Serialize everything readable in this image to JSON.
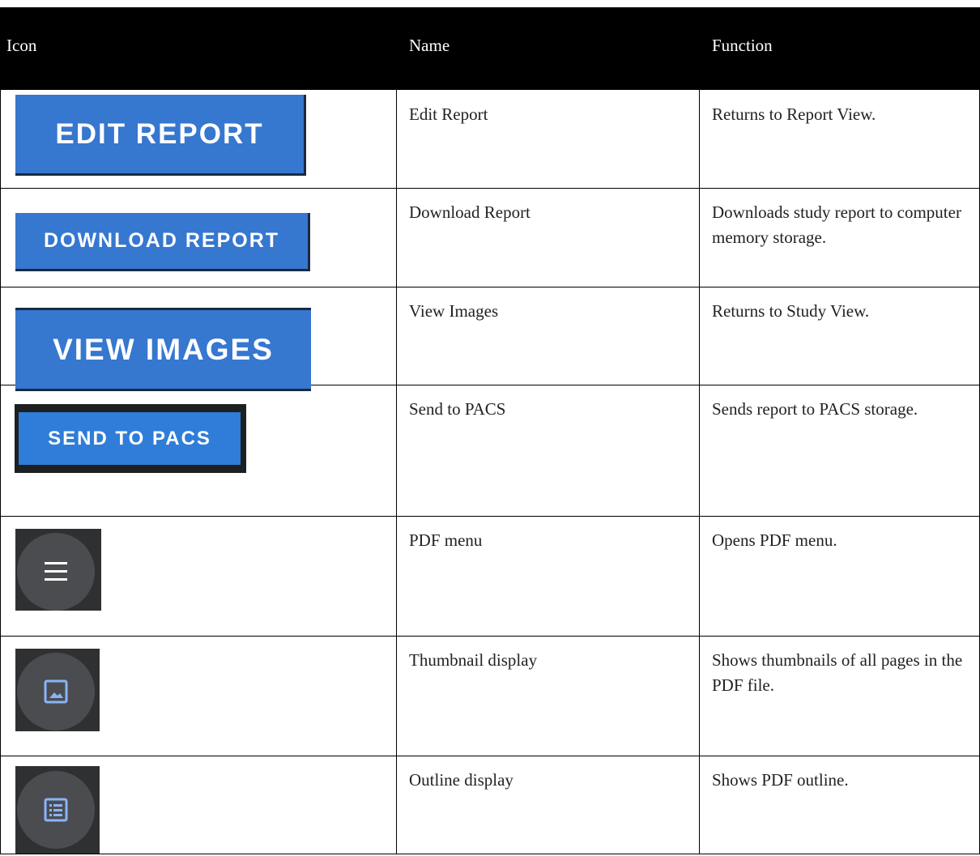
{
  "headers": {
    "icon": "Icon",
    "name": "Name",
    "function": "Function"
  },
  "rows": [
    {
      "button_label": "EDIT REPORT",
      "name": "Edit Report",
      "function": "Returns to Report View."
    },
    {
      "button_label": "DOWNLOAD REPORT",
      "name": "Download Report",
      "function": "Downloads study report to computer memory storage."
    },
    {
      "button_label": "VIEW IMAGES",
      "name": "View Images",
      "function": "Returns to Study View."
    },
    {
      "button_label": "SEND TO PACS",
      "name": "Send to PACS",
      "function": "Sends report to PACS storage."
    },
    {
      "icon": "hamburger-menu-icon",
      "name": "PDF menu",
      "function": "Opens PDF menu."
    },
    {
      "icon": "image-thumbnail-icon",
      "name": "Thumbnail display",
      "function": "Shows thumbnails of all pages in the PDF file."
    },
    {
      "icon": "list-outline-icon",
      "name": "Outline display",
      "function": "Shows PDF outline."
    }
  ],
  "colors": {
    "header_bg": "#000000",
    "button_blue": "#3677cf",
    "icon_tile": "#2f3032",
    "icon_circle": "#4a4c50",
    "icon_blue": "#8ab4f8"
  }
}
